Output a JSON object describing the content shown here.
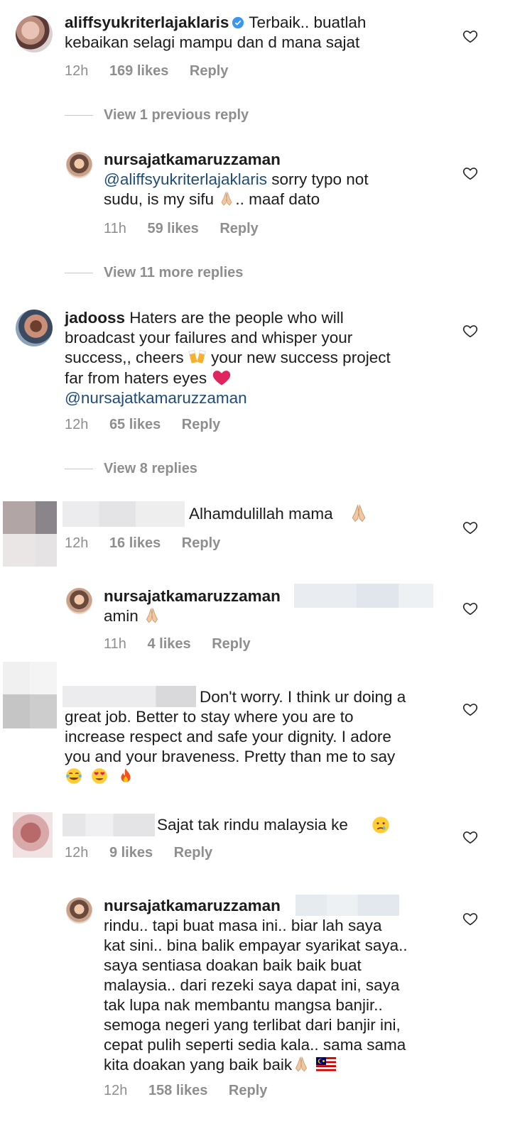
{
  "comments": [
    {
      "username": "aliffsyukriterlajaklaris",
      "verified": true,
      "text_line1": "Terbaik.. buatlah",
      "text_line2": "kebaikan selagi mampu dan d mana sajat",
      "time": "12h",
      "likes": "169 likes",
      "reply": "Reply",
      "view_replies": "View 1 previous reply"
    },
    {
      "username": "nursajatkamaruzzaman",
      "mention": "@aliffsyukriterlajaklaris",
      "text_line1_rest": "sorry typo not",
      "text_line2": "sudu, is my sifu",
      "text_line2_end": ".. maaf dato",
      "time": "11h",
      "likes": "59 likes",
      "reply": "Reply",
      "view_replies": "View 11 more replies"
    },
    {
      "username": "jadooss",
      "text_line1": "Haters are the people who will",
      "text_line2": "broadcast your failures and whisper your",
      "text_line3a": "success,, cheers",
      "text_line3b": "your new success  project",
      "text_line4": "far from haters eyes",
      "mention": "@nursajatkamaruzzaman",
      "time": "12h",
      "likes": "65 likes",
      "reply": "Reply",
      "view_replies": "View 8 replies"
    },
    {
      "text": "Alhamdulillah mama",
      "time": "12h",
      "likes": "16 likes",
      "reply": "Reply"
    },
    {
      "username": "nursajatkamaruzzaman",
      "text": "amin",
      "time": "11h",
      "likes": "4 likes",
      "reply": "Reply"
    },
    {
      "text_line1": "Don't worry. I think ur doing a",
      "text_line2": "great job. Better to stay where you are to",
      "text_line3": "increase respect and safe your dignity. I adore",
      "text_line4": "you and your braveness. Pretty than me to say"
    },
    {
      "text": "Sajat tak rindu malaysia ke",
      "time": "12h",
      "likes": "9 likes",
      "reply": "Reply"
    },
    {
      "username": "nursajatkamaruzzaman",
      "lines": [
        "rindu.. tapi buat masa ini.. biar lah saya",
        "kat sini.. bina balik empayar syarikat saya..",
        "saya sentiasa doakan baik baik buat",
        "malaysia.. dari rezeki saya dapat ini, saya",
        "tak lupa nak membantu mangsa banjir..",
        "semoga negeri yang terlibat dari banjir ini,",
        "cepat pulih seperti sedia kala.. sama sama",
        "kita doakan yang baik baik"
      ],
      "time": "12h",
      "likes": "158 likes",
      "reply": "Reply"
    }
  ],
  "icons": {
    "heart": "heart-outline-icon",
    "verified": "verified-badge-icon",
    "pray": "folded-hands-emoji",
    "beers": "clinking-beer-emoji",
    "red_heart": "red-heart-emoji",
    "laugh": "tears-of-joy-emoji",
    "heart_eyes": "heart-eyes-emoji",
    "fire": "fire-emoji",
    "sad": "crying-face-emoji",
    "flag": "malaysia-flag-emoji"
  },
  "colors": {
    "text": "#1c1c1c",
    "meta": "#8e8e8e",
    "mention": "#1e4c7a",
    "verified": "#3897f0",
    "heart_emoji": "#e0245e"
  }
}
